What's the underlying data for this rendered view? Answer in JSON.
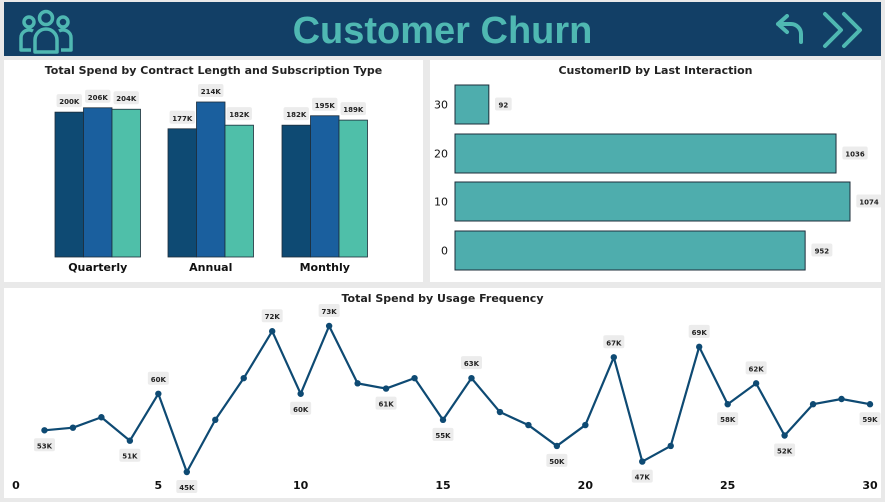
{
  "header": {
    "title": "Customer Churn",
    "icons": [
      "people-icon",
      "back-arrow-icon",
      "forward-chevrons-icon"
    ],
    "bg_color": "#123f66",
    "accent_color": "#4fb8b2"
  },
  "chart_data": [
    {
      "type": "bar",
      "title": "Total Spend by Contract Length and Subscription Type",
      "categories": [
        "Quarterly",
        "Annual",
        "Monthly"
      ],
      "series": [
        {
          "values": [
            200,
            177,
            182
          ],
          "labels": [
            "200K",
            "177K",
            "182K"
          ],
          "color": "#0e4a73"
        },
        {
          "values": [
            206,
            214,
            195
          ],
          "labels": [
            "206K",
            "214K",
            "195K"
          ],
          "color": "#1a5f9e"
        },
        {
          "values": [
            204,
            182,
            189
          ],
          "labels": [
            "204K",
            "182K",
            "189K"
          ],
          "color": "#4fbfa9"
        }
      ],
      "ylim": [
        0,
        214
      ]
    },
    {
      "type": "bar",
      "orientation": "horizontal",
      "title": "CustomerID by Last Interaction",
      "categories": [
        "30",
        "20",
        "10",
        "0"
      ],
      "values": [
        92,
        1036,
        1074,
        952
      ],
      "labels": [
        "92",
        "1036",
        "1074",
        "952"
      ],
      "color": "#4eadad",
      "xlim": [
        0,
        1074
      ]
    },
    {
      "type": "line",
      "title": "Total Spend by Usage Frequency",
      "x": [
        1,
        2,
        3,
        4,
        5,
        6,
        7,
        8,
        9,
        10,
        11,
        12,
        13,
        14,
        15,
        16,
        17,
        18,
        19,
        20,
        21,
        22,
        23,
        24,
        25,
        26,
        27,
        28,
        29,
        30
      ],
      "values": [
        53,
        53.5,
        55.5,
        51,
        60,
        45,
        55,
        63,
        72,
        60,
        73,
        62,
        61,
        63,
        55,
        63,
        56.5,
        54,
        50,
        54,
        67,
        47,
        50,
        69,
        58,
        62,
        52,
        58,
        59,
        58
      ],
      "point_labels": {
        "1": "53K",
        "4": "51K",
        "5": "60K",
        "6": "45K",
        "9": "72K",
        "10": "60K",
        "11": "73K",
        "13": "61K",
        "15": "55K",
        "16": "63K",
        "19": "50K",
        "21": "67K",
        "22": "47K",
        "24": "69K",
        "25": "58K",
        "26": "62K",
        "27": "52K",
        "30": "59K"
      },
      "x_ticks": [
        "0",
        "5",
        "10",
        "15",
        "20",
        "25",
        "30"
      ],
      "xlim": [
        0,
        30
      ],
      "ylim": [
        45,
        73
      ],
      "color": "#0e4a73"
    }
  ]
}
